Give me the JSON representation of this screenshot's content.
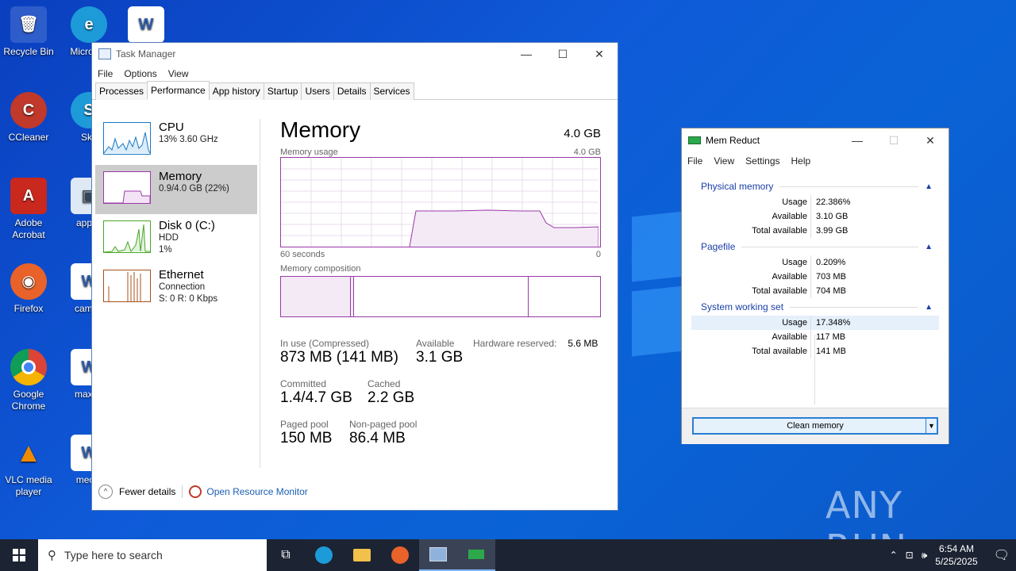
{
  "desktop": {
    "icons": [
      {
        "label": "Recycle Bin"
      },
      {
        "label": "Micro Ed"
      },
      {
        "label": ""
      },
      {
        "label": "CCleaner"
      },
      {
        "label": "Sky"
      },
      {
        "label": "Adobe Acrobat"
      },
      {
        "label": "applie"
      },
      {
        "label": "Firefox"
      },
      {
        "label": "campu"
      },
      {
        "label": "Google Chrome"
      },
      {
        "label": "maxon"
      },
      {
        "label": "VLC media player"
      },
      {
        "label": "meoffi"
      }
    ],
    "watermark": "ANY RUN"
  },
  "task_manager": {
    "title": "Task Manager",
    "menu": [
      "File",
      "Options",
      "View"
    ],
    "tabs": [
      "Processes",
      "Performance",
      "App history",
      "Startup",
      "Users",
      "Details",
      "Services"
    ],
    "active_tab": "Performance",
    "sidebar": [
      {
        "title": "CPU",
        "line1": "13%  3.60 GHz",
        "line2": ""
      },
      {
        "title": "Memory",
        "line1": "0.9/4.0 GB (22%)",
        "line2": ""
      },
      {
        "title": "Disk 0 (C:)",
        "line1": "HDD",
        "line2": "1%"
      },
      {
        "title": "Ethernet",
        "line1": "Connection",
        "line2": "S: 0  R: 0 Kbps"
      }
    ],
    "main": {
      "title": "Memory",
      "capacity": "4.0 GB",
      "usage_label": "Memory usage",
      "usage_max": "4.0 GB",
      "time_left": "60 seconds",
      "time_right": "0",
      "composition_label": "Memory composition",
      "stats": {
        "in_use_label": "In use (Compressed)",
        "in_use": "873 MB (141 MB)",
        "available_label": "Available",
        "available": "3.1 GB",
        "hw_reserved_label": "Hardware reserved:",
        "hw_reserved": "5.6 MB",
        "committed_label": "Committed",
        "committed": "1.4/4.7 GB",
        "cached_label": "Cached",
        "cached": "2.2 GB",
        "paged_label": "Paged pool",
        "paged": "150 MB",
        "nonpaged_label": "Non-paged pool",
        "nonpaged": "86.4 MB"
      }
    },
    "footer": {
      "fewer": "Fewer details",
      "resmon": "Open Resource Monitor"
    }
  },
  "mem_reduct": {
    "title": "Mem Reduct",
    "menu": [
      "File",
      "View",
      "Settings",
      "Help"
    ],
    "groups": [
      {
        "name": "Physical memory",
        "rows": [
          [
            "Usage",
            "22.386%"
          ],
          [
            "Available",
            "3.10 GB"
          ],
          [
            "Total available",
            "3.99 GB"
          ]
        ]
      },
      {
        "name": "Pagefile",
        "rows": [
          [
            "Usage",
            "0.209%"
          ],
          [
            "Available",
            "703 MB"
          ],
          [
            "Total available",
            "704 MB"
          ]
        ]
      },
      {
        "name": "System working set",
        "rows": [
          [
            "Usage",
            "17.348%"
          ],
          [
            "Available",
            "117 MB"
          ],
          [
            "Total available",
            "141 MB"
          ]
        ]
      }
    ],
    "clean_button": "Clean memory"
  },
  "taskbar": {
    "search_placeholder": "Type here to search",
    "time": "6:54 AM",
    "date": "5/25/2025"
  },
  "colors": {
    "memory_accent": "#9a3aa8",
    "cpu_accent": "#1778c6",
    "disk_accent": "#4aa628",
    "ethernet_accent": "#a8501a",
    "desktop_bg": "#0a4fc8"
  }
}
